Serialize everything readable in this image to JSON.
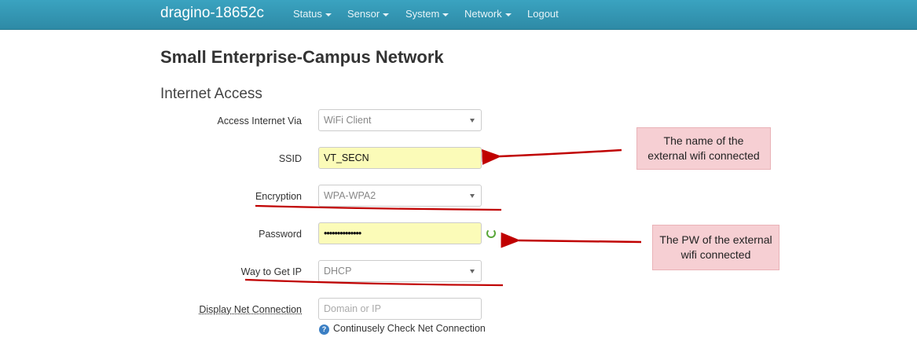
{
  "navbar": {
    "brand": "dragino-18652c",
    "items": [
      {
        "label": "Status",
        "has_caret": true
      },
      {
        "label": "Sensor",
        "has_caret": true
      },
      {
        "label": "System",
        "has_caret": true
      },
      {
        "label": "Network",
        "has_caret": true
      },
      {
        "label": "Logout",
        "has_caret": false
      }
    ]
  },
  "page": {
    "title": "Small Enterprise-Campus Network",
    "section": "Internet Access"
  },
  "form": {
    "access_via": {
      "label": "Access Internet Via",
      "value": "WiFi Client"
    },
    "ssid": {
      "label": "SSID",
      "value": "VT_SECN"
    },
    "encryption": {
      "label": "Encryption",
      "value": "WPA-WPA2"
    },
    "password": {
      "label": "Password",
      "value": "••••••••••••••"
    },
    "way_to_get_ip": {
      "label": "Way to Get IP",
      "value": "DHCP"
    },
    "display_net_connection": {
      "label": "Display Net Connection",
      "placeholder": "Domain or IP"
    },
    "help_text": "Continusely Check Net Connection"
  },
  "annotations": {
    "callout_ssid": {
      "line1": "The name of the",
      "line2": "external wifi connected"
    },
    "callout_password": {
      "line1": "The PW of the external",
      "line2": "wifi connected"
    },
    "color": "#c00000"
  },
  "colors": {
    "navbar": "#3499b6",
    "field_highlight": "#fbfbb8",
    "callout_bg": "#f6cfd3"
  }
}
